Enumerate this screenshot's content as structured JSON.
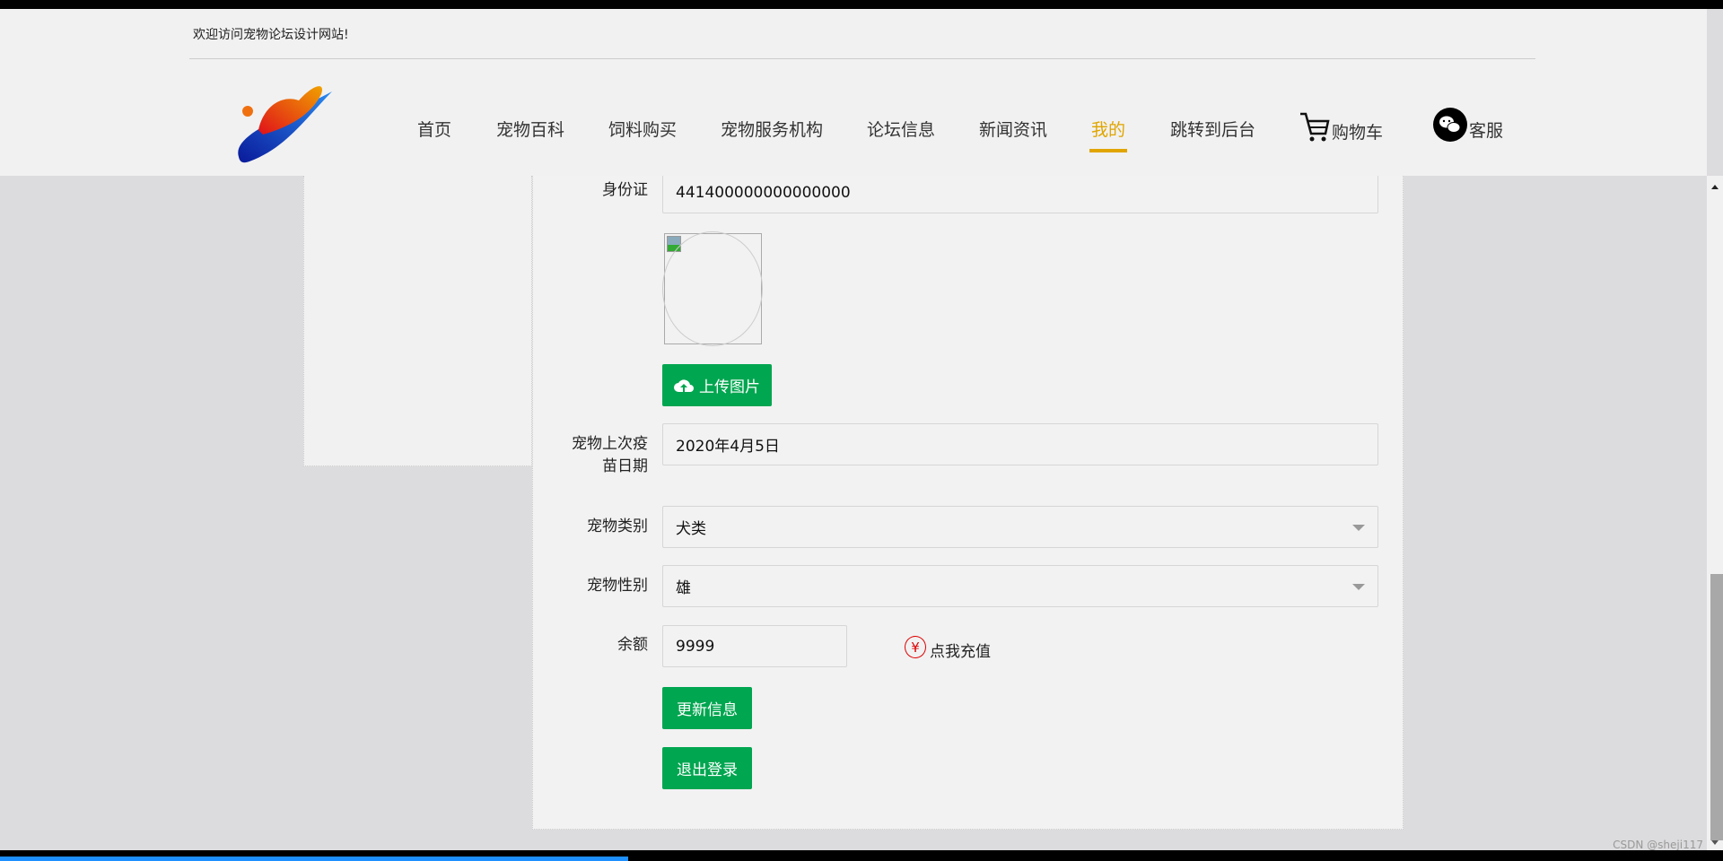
{
  "header": {
    "welcome": "欢迎访问宠物论坛设计网站!"
  },
  "nav": [
    "首页",
    "宠物百科",
    "饲料购买",
    "宠物服务机构",
    "论坛信息",
    "新闻资讯",
    "我的",
    "跳转到后台"
  ],
  "nav_active": "我的",
  "cart_label": "购物车",
  "service_label": "客服",
  "form": {
    "id_label": "身份证",
    "id_value": "441400000000000000",
    "upload_label": "上传图片",
    "vaccine_label_1": "宠物上次疫",
    "vaccine_label_2": "苗日期",
    "vaccine_value": "2020年4月5日",
    "category_label": "宠物类别",
    "category_value": "犬类",
    "gender_label": "宠物性别",
    "gender_value": "雄",
    "balance_label": "余额",
    "balance_value": "9999",
    "recharge_label": "点我充值",
    "recharge_symbol": "¥",
    "update_label": "更新信息",
    "logout_label": "退出登录"
  },
  "watermark": "CSDN @sheji117",
  "colors": {
    "accent": "#e0a500",
    "button": "#00a650"
  }
}
